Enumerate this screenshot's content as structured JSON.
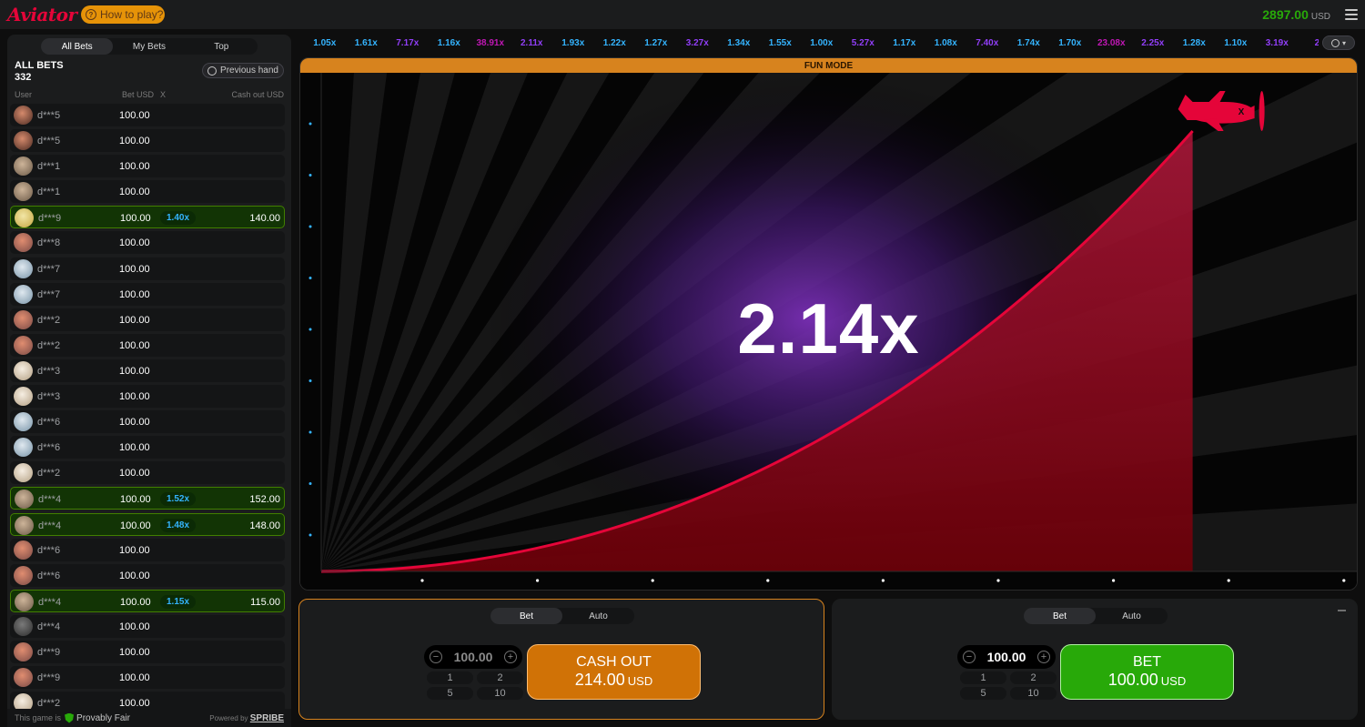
{
  "header": {
    "logo": "Aviator",
    "how_to_play": "How to play?",
    "balance": "2897.00",
    "currency": "USD"
  },
  "sidebar": {
    "tabs": [
      "All Bets",
      "My Bets",
      "Top"
    ],
    "title": "ALL BETS",
    "count": "332",
    "previous_hand": "Previous hand",
    "columns": {
      "user": "User",
      "bet": "Bet USD",
      "x": "X",
      "cashout": "Cash out USD"
    },
    "rows": [
      {
        "user": "d***5",
        "bet": "100.00",
        "x": "",
        "cashout": "",
        "avatar": "a1"
      },
      {
        "user": "d***5",
        "bet": "100.00",
        "x": "",
        "cashout": "",
        "avatar": "a1"
      },
      {
        "user": "d***1",
        "bet": "100.00",
        "x": "",
        "cashout": "",
        "avatar": "a2"
      },
      {
        "user": "d***1",
        "bet": "100.00",
        "x": "",
        "cashout": "",
        "avatar": "a2"
      },
      {
        "user": "d***9",
        "bet": "100.00",
        "x": "1.40x",
        "cashout": "140.00",
        "avatar": "a3"
      },
      {
        "user": "d***8",
        "bet": "100.00",
        "x": "",
        "cashout": "",
        "avatar": "a4"
      },
      {
        "user": "d***7",
        "bet": "100.00",
        "x": "",
        "cashout": "",
        "avatar": "a5"
      },
      {
        "user": "d***7",
        "bet": "100.00",
        "x": "",
        "cashout": "",
        "avatar": "a5"
      },
      {
        "user": "d***2",
        "bet": "100.00",
        "x": "",
        "cashout": "",
        "avatar": "a4"
      },
      {
        "user": "d***2",
        "bet": "100.00",
        "x": "",
        "cashout": "",
        "avatar": "a4"
      },
      {
        "user": "d***3",
        "bet": "100.00",
        "x": "",
        "cashout": "",
        "avatar": "a6"
      },
      {
        "user": "d***3",
        "bet": "100.00",
        "x": "",
        "cashout": "",
        "avatar": "a6"
      },
      {
        "user": "d***6",
        "bet": "100.00",
        "x": "",
        "cashout": "",
        "avatar": "a5"
      },
      {
        "user": "d***6",
        "bet": "100.00",
        "x": "",
        "cashout": "",
        "avatar": "a5"
      },
      {
        "user": "d***2",
        "bet": "100.00",
        "x": "",
        "cashout": "",
        "avatar": "a6"
      },
      {
        "user": "d***4",
        "bet": "100.00",
        "x": "1.52x",
        "cashout": "152.00",
        "avatar": "a2"
      },
      {
        "user": "d***4",
        "bet": "100.00",
        "x": "1.48x",
        "cashout": "148.00",
        "avatar": "a2"
      },
      {
        "user": "d***6",
        "bet": "100.00",
        "x": "",
        "cashout": "",
        "avatar": "a4"
      },
      {
        "user": "d***6",
        "bet": "100.00",
        "x": "",
        "cashout": "",
        "avatar": "a4"
      },
      {
        "user": "d***4",
        "bet": "100.00",
        "x": "1.15x",
        "cashout": "115.00",
        "avatar": "a2"
      },
      {
        "user": "d***4",
        "bet": "100.00",
        "x": "",
        "cashout": "",
        "avatar": "a7"
      },
      {
        "user": "d***9",
        "bet": "100.00",
        "x": "",
        "cashout": "",
        "avatar": "a4"
      },
      {
        "user": "d***9",
        "bet": "100.00",
        "x": "",
        "cashout": "",
        "avatar": "a4"
      },
      {
        "user": "d***2",
        "bet": "100.00",
        "x": "",
        "cashout": "",
        "avatar": "a6"
      }
    ],
    "footer": {
      "game_is": "This game is",
      "provably_fair": "Provably Fair",
      "powered_by": "Powered by",
      "brand": "SPRIBE"
    }
  },
  "history": [
    {
      "v": "1.05x",
      "c": "blue"
    },
    {
      "v": "1.61x",
      "c": "blue"
    },
    {
      "v": "7.17x",
      "c": "purple"
    },
    {
      "v": "1.16x",
      "c": "blue"
    },
    {
      "v": "38.91x",
      "c": "pink"
    },
    {
      "v": "2.11x",
      "c": "purple"
    },
    {
      "v": "1.93x",
      "c": "blue"
    },
    {
      "v": "1.22x",
      "c": "blue"
    },
    {
      "v": "1.27x",
      "c": "blue"
    },
    {
      "v": "3.27x",
      "c": "purple"
    },
    {
      "v": "1.34x",
      "c": "blue"
    },
    {
      "v": "1.55x",
      "c": "blue"
    },
    {
      "v": "1.00x",
      "c": "blue"
    },
    {
      "v": "5.27x",
      "c": "purple"
    },
    {
      "v": "1.17x",
      "c": "blue"
    },
    {
      "v": "1.08x",
      "c": "blue"
    },
    {
      "v": "7.40x",
      "c": "purple"
    },
    {
      "v": "1.74x",
      "c": "blue"
    },
    {
      "v": "1.70x",
      "c": "blue"
    },
    {
      "v": "23.08x",
      "c": "pink"
    },
    {
      "v": "2.25x",
      "c": "purple"
    },
    {
      "v": "1.28x",
      "c": "blue"
    },
    {
      "v": "1.10x",
      "c": "blue"
    },
    {
      "v": "3.19x",
      "c": "purple"
    },
    {
      "v": "2.",
      "c": "purple"
    }
  ],
  "game": {
    "mode_label": "FUN MODE",
    "multiplier": "2.14x",
    "progress": 0.84
  },
  "panel1": {
    "tabs": [
      "Bet",
      "Auto"
    ],
    "amount": "100.00",
    "quick": [
      "1",
      "2",
      "5",
      "10"
    ],
    "button_line1": "CASH OUT",
    "button_amount": "214.00",
    "button_currency": "USD"
  },
  "panel2": {
    "tabs": [
      "Bet",
      "Auto"
    ],
    "amount": "100.00",
    "quick": [
      "1",
      "2",
      "5",
      "10"
    ],
    "button_line1": "BET",
    "button_amount": "100.00",
    "button_currency": "USD"
  },
  "colors": {
    "brand_red": "#e50539",
    "balance_green": "#28a909",
    "mult_blue": "#34b4ff",
    "mult_purple": "#913ef8",
    "mult_pink": "#c017b4",
    "cashout_orange": "#d07206",
    "bet_green": "#28a909"
  }
}
